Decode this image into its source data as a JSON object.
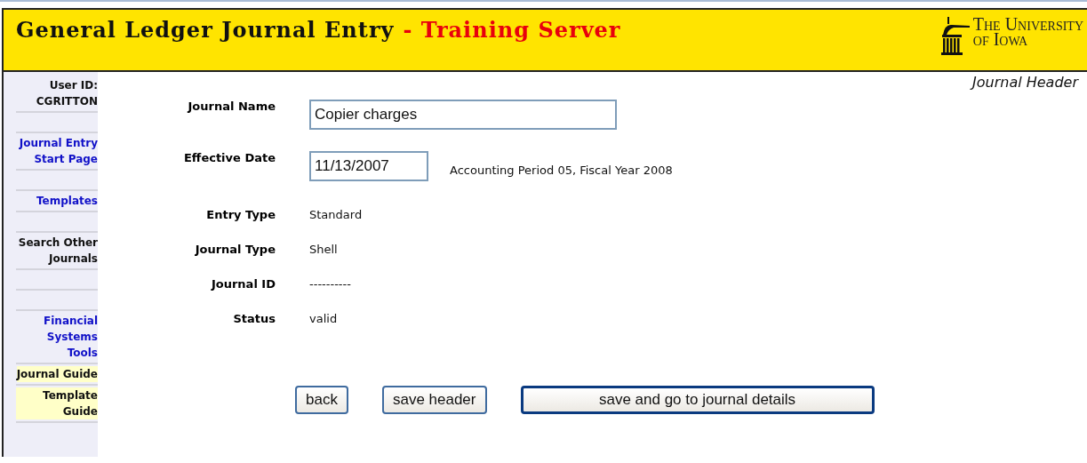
{
  "header": {
    "title": "General Ledger Journal Entry",
    "subtitle": "- Training Server",
    "logo_lines": [
      "The University",
      "of Iowa"
    ]
  },
  "page_label": "Journal Header",
  "sidebar": {
    "user_label": "User ID:",
    "user_id": "CGRITTON",
    "items": [
      {
        "kind": "link",
        "label": "Journal Entry Start Page"
      },
      {
        "kind": "blank"
      },
      {
        "kind": "link",
        "label": "Templates"
      },
      {
        "kind": "blank"
      },
      {
        "kind": "text",
        "label": "Search Other Journals"
      },
      {
        "kind": "blank"
      },
      {
        "kind": "blank"
      },
      {
        "kind": "link",
        "label": "Financial Systems Tools"
      },
      {
        "kind": "guide",
        "label": "Journal Guide"
      },
      {
        "kind": "guide",
        "label": "Template Guide"
      }
    ]
  },
  "form": [
    {
      "kind": "name_input",
      "label": "Journal Name",
      "value": "Copier charges"
    },
    {
      "kind": "date_input",
      "label": "Effective Date",
      "value": "11/13/2007",
      "note": "Accounting Period 05, Fiscal Year 2008"
    },
    {
      "kind": "text",
      "label": "Entry Type",
      "value": "Standard"
    },
    {
      "kind": "text",
      "label": "Journal Type",
      "value": "Shell"
    },
    {
      "kind": "text",
      "label": "Journal ID",
      "value": "----------"
    },
    {
      "kind": "text",
      "label": "Status",
      "value": "valid"
    }
  ],
  "buttons": [
    {
      "label": "back",
      "default": false
    },
    {
      "label": "save header",
      "default": false
    },
    {
      "label": "save and go to journal details",
      "default": true
    }
  ]
}
